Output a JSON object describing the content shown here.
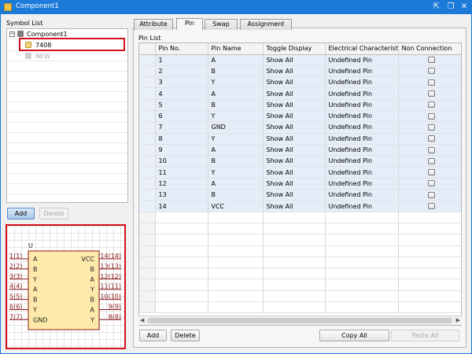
{
  "window": {
    "title": "Component1",
    "controls": [
      "⇱",
      "❐",
      "✕"
    ]
  },
  "left": {
    "symbol_list_label": "Symbol List",
    "tree": [
      {
        "label": "Component1",
        "kind": "root"
      },
      {
        "label": "7408",
        "kind": "child",
        "selected": true
      },
      {
        "label": "NEW",
        "kind": "child-disabled"
      }
    ],
    "add_label": "Add",
    "delete_label": "Delete"
  },
  "symbol": {
    "ref": "U",
    "left_pins": [
      {
        "num": "1(1)",
        "name": "A"
      },
      {
        "num": "2(2)",
        "name": "B"
      },
      {
        "num": "3(3)",
        "name": "Y"
      },
      {
        "num": "4(4)",
        "name": "A"
      },
      {
        "num": "5(5)",
        "name": "B"
      },
      {
        "num": "6(6)",
        "name": "Y"
      },
      {
        "num": "7(7)",
        "name": "GND"
      }
    ],
    "right_pins": [
      {
        "num": "14(14)",
        "name": "VCC"
      },
      {
        "num": "13(13)",
        "name": "B"
      },
      {
        "num": "12(12)",
        "name": "A"
      },
      {
        "num": "11(11)",
        "name": "Y"
      },
      {
        "num": "10(10)",
        "name": "B"
      },
      {
        "num": "9(9)",
        "name": "A"
      },
      {
        "num": "8(8)",
        "name": "Y"
      }
    ]
  },
  "tabs": [
    "Attribute",
    "Pin",
    "Swap",
    "Assignment"
  ],
  "active_tab": "Pin",
  "pin_list_label": "Pin List",
  "pin_table": {
    "columns": [
      "Pin No.",
      "Pin Name",
      "Toggle Display",
      "Electrical Characteristics",
      "Non Connection"
    ],
    "rows": [
      [
        "1",
        "A",
        "Show All",
        "Undefined Pin"
      ],
      [
        "2",
        "B",
        "Show All",
        "Undefined Pin"
      ],
      [
        "3",
        "Y",
        "Show All",
        "Undefined Pin"
      ],
      [
        "4",
        "A",
        "Show All",
        "Undefined Pin"
      ],
      [
        "5",
        "B",
        "Show All",
        "Undefined Pin"
      ],
      [
        "6",
        "Y",
        "Show All",
        "Undefined Pin"
      ],
      [
        "7",
        "GND",
        "Show All",
        "Undefined Pin"
      ],
      [
        "8",
        "Y",
        "Show All",
        "Undefined Pin"
      ],
      [
        "9",
        "A",
        "Show All",
        "Undefined Pin"
      ],
      [
        "10",
        "B",
        "Show All",
        "Undefined Pin"
      ],
      [
        "11",
        "Y",
        "Show All",
        "Undefined Pin"
      ],
      [
        "12",
        "A",
        "Show All",
        "Undefined Pin"
      ],
      [
        "13",
        "B",
        "Show All",
        "Undefined Pin"
      ],
      [
        "14",
        "VCC",
        "Show All",
        "Undefined Pin"
      ]
    ],
    "empty_rows": 9
  },
  "bottom_buttons": {
    "add": "Add",
    "delete": "Delete",
    "copy_all": "Copy All",
    "paste_all": "Paste All"
  },
  "colors": {
    "title_bar": "#1c7ad8",
    "highlight": "#d4101a",
    "symbol_outline": "#8b1a1a",
    "symbol_fill": "#fde9a9",
    "row_selected": "#e5edf8"
  }
}
